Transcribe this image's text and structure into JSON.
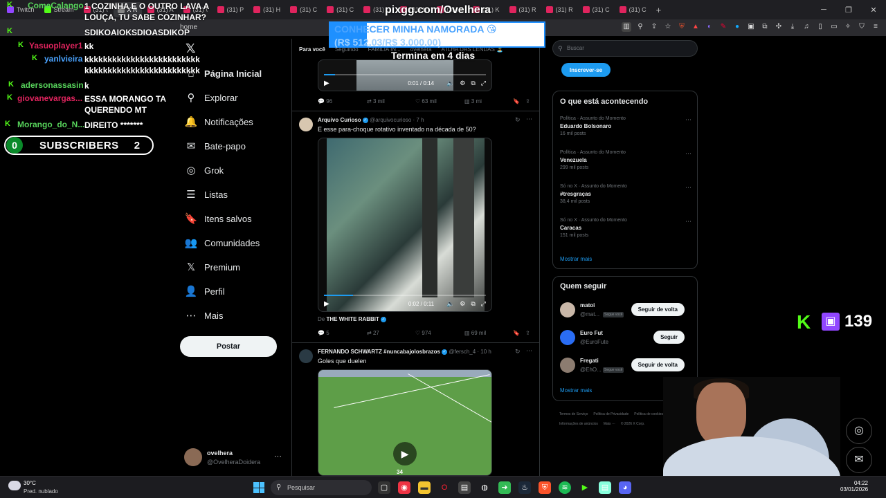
{
  "browser": {
    "tabs": [
      {
        "label": "Twitch",
        "color": "#9146ff"
      },
      {
        "label": "Stream",
        "color": "#53fc18"
      },
      {
        "label": "(31) \\",
        "color": "#e0245e"
      },
      {
        "label": "X R",
        "color": "#888888"
      },
      {
        "label": "(31) A",
        "color": "#e0245e"
      },
      {
        "label": "(31) \\",
        "color": "#e0245e"
      },
      {
        "label": "(31) P",
        "color": "#e0245e"
      },
      {
        "label": "(31) H",
        "color": "#e0245e"
      },
      {
        "label": "(31) C",
        "color": "#e0245e"
      },
      {
        "label": "(31) C",
        "color": "#e0245e"
      },
      {
        "label": "(31) C",
        "color": "#e0245e"
      },
      {
        "label": "(31) N",
        "color": "#e0245e"
      },
      {
        "label": "(31) T",
        "color": "#e0245e"
      },
      {
        "label": "(31) K",
        "color": "#e0245e"
      },
      {
        "label": "(31) R",
        "color": "#e0245e"
      },
      {
        "label": "(31) R",
        "color": "#e0245e"
      },
      {
        "label": "(31) C",
        "color": "#e0245e"
      },
      {
        "label": "(31) C",
        "color": "#e0245e"
      }
    ],
    "new_tab": "+",
    "url_fragment": "home"
  },
  "overlay": {
    "pix_title": "pixgg.com/Ovelhera",
    "goal_title": "CONHECER MINHA NAMORADA 😘",
    "goal_amount": "(R$ 512,03/R$ 3.000,00)",
    "goal_progress": 0.17,
    "goal_ends": "Termina em 4 dias",
    "subs_left": "0",
    "subs_label": "SUBSCRIBERS",
    "subs_right": "2",
    "viewers": "139"
  },
  "chat": [
    {
      "user": "ComeCalango",
      "msg": "1 COZINHA E O OUTRO LAVA A LOUÇA, TU SABE COZINHAR?",
      "user_color": "#57d35b"
    },
    {
      "user": "",
      "msg": "SDIKOAIOKSDIOASDIKOP",
      "user_color": "#e0245e"
    },
    {
      "user": "Yasuoplayer1",
      "msg": "kk",
      "user_color": "#e0245e"
    },
    {
      "user": "yanlvieira",
      "msg": "kkkkkkkkkkkkkkkkkkkkkkkkk kkkkkkkkkkkkkkkkkkkkkkkkk",
      "user_color": "#4aa3ff"
    },
    {
      "user": "adersonassasin",
      "msg": "k",
      "user_color": "#57d35b"
    },
    {
      "user": "giovanevargas...",
      "msg": "ESSA MORANGO TA QUERENDO MT",
      "user_color": "#e0245e"
    },
    {
      "user": "Morango_do_N...",
      "msg": "DIREITO *******",
      "user_color": "#57d35b"
    }
  ],
  "x": {
    "nav": [
      {
        "label": "Página Inicial",
        "icon": "home-icon",
        "glyph": "⌂"
      },
      {
        "label": "Explorar",
        "icon": "search-icon",
        "glyph": "⚲"
      },
      {
        "label": "Notificações",
        "icon": "bell-icon",
        "glyph": "🔔"
      },
      {
        "label": "Bate-papo",
        "icon": "mail-icon",
        "glyph": "✉"
      },
      {
        "label": "Grok",
        "icon": "grok-icon",
        "glyph": "◎"
      },
      {
        "label": "Listas",
        "icon": "list-icon",
        "glyph": "☰"
      },
      {
        "label": "Itens salvos",
        "icon": "bookmark-icon",
        "glyph": "🔖"
      },
      {
        "label": "Comunidades",
        "icon": "communities-icon",
        "glyph": "👥"
      },
      {
        "label": "Premium",
        "icon": "x-premium-icon",
        "glyph": "𝕏"
      },
      {
        "label": "Perfil",
        "icon": "person-icon",
        "glyph": "👤"
      },
      {
        "label": "Mais",
        "icon": "more-circle-icon",
        "glyph": "⋯"
      }
    ],
    "post_button": "Postar",
    "profile_name": "ovelhera",
    "profile_handle": "@OvelheraDoidera",
    "profile_more": "···",
    "tabs": [
      "Para você",
      "Seguindo",
      "FAMÍLIA IN...",
      "ovelhera",
      "A ILHA DAS LENDAS 🏝️"
    ],
    "post1": {
      "video_time": "0:01 / 0:14",
      "video_progress": 0.07,
      "replies": "96",
      "reposts": "3 mil",
      "likes": "63 mil",
      "views": "3 mi"
    },
    "post2": {
      "name": "Arquivo Curioso",
      "handle": "@arquivocurioso",
      "time": "· 7 h",
      "text": "E esse para-choque rotativo inventado na década de 50?",
      "video_time": "0:02 / 0:11",
      "video_progress": 0.18,
      "source_prefix": "De",
      "source": "THE WHITE RABBIT",
      "replies": "5",
      "reposts": "27",
      "likes": "974",
      "views": "69 mil"
    },
    "post3": {
      "name": "FERNANDO SCHWARTZ #nuncabajolosbrazos",
      "handle": "@fersch_4",
      "time": "· 10 h",
      "text": "Goles que duelen",
      "score": "34"
    },
    "search_placeholder": "Buscar",
    "subscribe_button": "Inscrever-se",
    "trends_title": "O que está acontecendo",
    "trends": [
      {
        "category": "Política · Assunto do Momento",
        "title": "Eduardo Bolsonaro",
        "count": "16 mil posts"
      },
      {
        "category": "Política · Assunto do Momento",
        "title": "Venezuela",
        "count": "299 mil posts"
      },
      {
        "category": "Só no X · Assunto do Momento",
        "title": "#tresgraças",
        "count": "38,4 mil posts"
      },
      {
        "category": "Só no X · Assunto do Momento",
        "title": "Caracas",
        "count": "151 mil posts"
      }
    ],
    "show_more": "Mostrar mais",
    "follow_title": "Quem seguir",
    "follow": [
      {
        "name": "matoi",
        "handle": "@mat...",
        "tag": "Segue você",
        "button": "Seguir de volta",
        "color": "#c9b7a8"
      },
      {
        "name": "Euro Fut",
        "handle": "@EuroFute",
        "tag": "",
        "button": "Seguir",
        "color": "#2a6df4"
      },
      {
        "name": "Fregati",
        "handle": "@EhO...",
        "tag": "Segue você",
        "button": "Seguir de volta",
        "color": "#8c7c70"
      }
    ],
    "footer": [
      "Termos de Serviço",
      "Política de Privacidade",
      "Política de cookies",
      "Acessibilidade",
      "Informações de anúncios",
      "Mais ···",
      "© 2026 X Corp."
    ]
  },
  "taskbar": {
    "temp": "30°C",
    "weather": "Pred. nublado",
    "search": "Pesquisar",
    "time": "04:22",
    "date": "03/01/2026"
  }
}
